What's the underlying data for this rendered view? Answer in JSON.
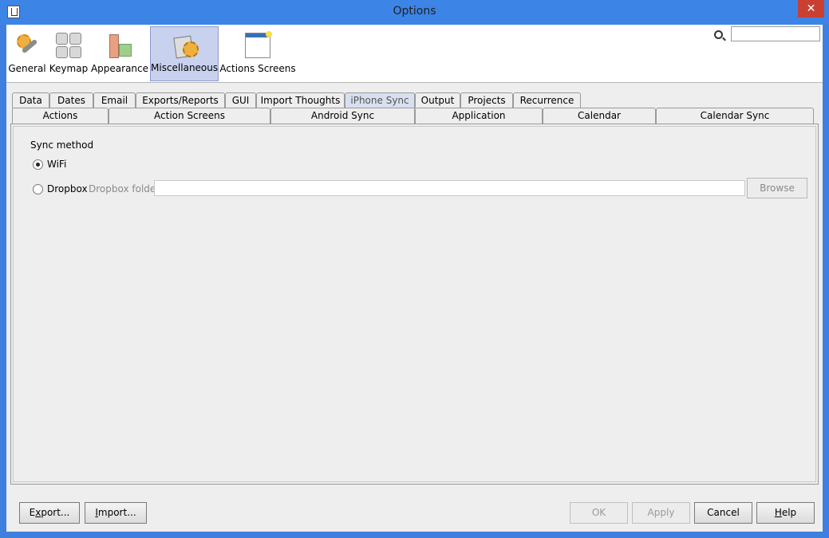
{
  "window": {
    "title": "Options",
    "close_glyph": "✕"
  },
  "toolbar": {
    "items": [
      {
        "label": "General",
        "icon": "general-icon"
      },
      {
        "label": "Keymap",
        "icon": "keymap-icon"
      },
      {
        "label": "Appearance",
        "icon": "appearance-icon"
      },
      {
        "label": "Miscellaneous",
        "icon": "miscellaneous-icon",
        "selected": true
      },
      {
        "label": "Actions Screens",
        "icon": "actions-screens-icon"
      }
    ],
    "search": {
      "value": "",
      "placeholder": ""
    }
  },
  "tabs": {
    "row1": [
      "Data",
      "Dates",
      "Email",
      "Exports/Reports",
      "GUI",
      "Import Thoughts",
      "iPhone Sync",
      "Output",
      "Projects",
      "Recurrence"
    ],
    "row2": [
      "Actions",
      "Action Screens",
      "Android Sync",
      "Application",
      "Calendar",
      "Calendar Sync"
    ],
    "active": "iPhone Sync"
  },
  "panel": {
    "sync_method_label": "Sync method",
    "options": [
      {
        "label": "WiFi",
        "checked": true
      },
      {
        "label": "Dropbox",
        "checked": false
      }
    ],
    "dropbox_folder_label": "Dropbox folder",
    "dropbox_folder_value": "",
    "browse_label": "Browse"
  },
  "buttons": {
    "export_pre": "E",
    "export_u": "x",
    "export_post": "port...",
    "import_u": "I",
    "import_post": "mport...",
    "ok": "OK",
    "apply": "Apply",
    "cancel": "Cancel",
    "help_u": "H",
    "help_post": "elp"
  }
}
